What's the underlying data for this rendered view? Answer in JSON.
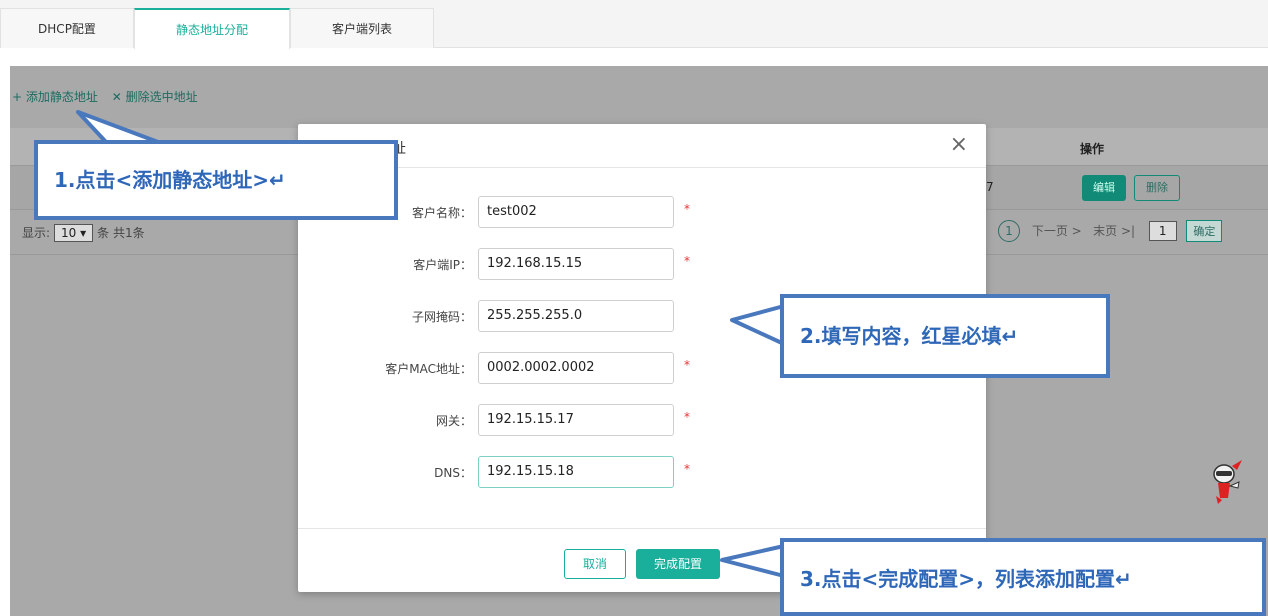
{
  "tabs": [
    {
      "label": "DHCP配置"
    },
    {
      "label": "静态地址分配"
    },
    {
      "label": "客户端列表"
    }
  ],
  "toolbar": {
    "add_label": "+ 添加静态地址",
    "delete_label": "✕ 删除选中地址"
  },
  "table": {
    "op_header": "操作",
    "row_tail": "7",
    "edit_label": "编辑",
    "delete_label": "删除"
  },
  "pager": {
    "show_label": "显示:",
    "page_size": "10 ▾",
    "total_label": "条 共1条",
    "current_page": "1",
    "next_label": "下一页 >",
    "last_label": "末页 >|",
    "page_input": "1",
    "confirm_label": "确定"
  },
  "modal": {
    "title": "址",
    "close": "×",
    "fields": [
      {
        "label": "客户名称：",
        "value": "test002",
        "required": "*"
      },
      {
        "label": "客户端IP：",
        "value": "192.168.15.15",
        "required": "*"
      },
      {
        "label": "子网掩码：",
        "value": "255.255.255.0",
        "required": ""
      },
      {
        "label": "客户MAC地址：",
        "value": "0002.0002.0002",
        "required": "*"
      },
      {
        "label": "网关：",
        "value": "192.15.15.17",
        "required": "*"
      },
      {
        "label": "DNS：",
        "value": "192.15.15.18",
        "required": "*"
      }
    ],
    "cancel_label": "取消",
    "finish_label": "完成配置"
  },
  "callouts": {
    "step1": "1.点击<添加静态地址>↵",
    "step2": "2.填写内容，红星必填↵",
    "step3": "3.点击<完成配置>，列表添加配置↵"
  },
  "colors": {
    "accent": "#1aaf9a",
    "callout_border": "#4a78bd",
    "required_star": "#e33333"
  }
}
